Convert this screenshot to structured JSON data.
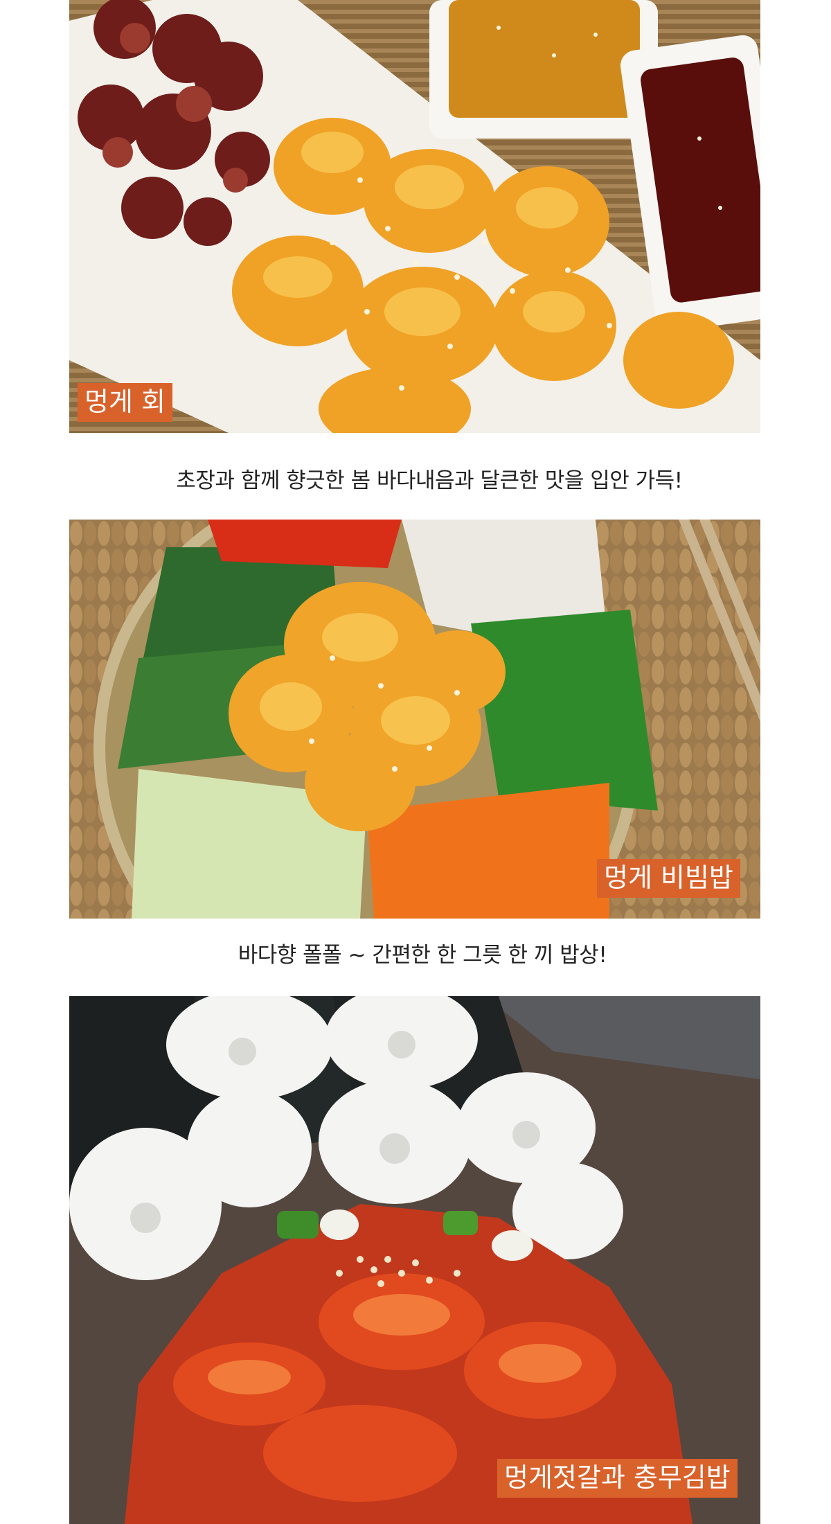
{
  "sections": [
    {
      "image_alt": "멍게 회 with dumplings and dipping sauces",
      "tag": "멍게 회",
      "caption": "초장과 함께 향긋한 봄 바다내음과 달큰한 맛을 입안 가득!"
    },
    {
      "image_alt": "멍게 비빔밥 bowl with vegetables",
      "tag": "멍게 비빔밥",
      "caption": "바다향 폴폴 ~ 간편한 한 그릇 한 끼 밥상!"
    },
    {
      "image_alt": "멍게젓갈과 충무김밥",
      "tag": "멍게젓갈과 충무김밥"
    }
  ],
  "colors": {
    "tag_background": "#d9622b",
    "tag_text": "#ffffff",
    "caption_text": "#222222",
    "page_background": "#ffffff"
  }
}
